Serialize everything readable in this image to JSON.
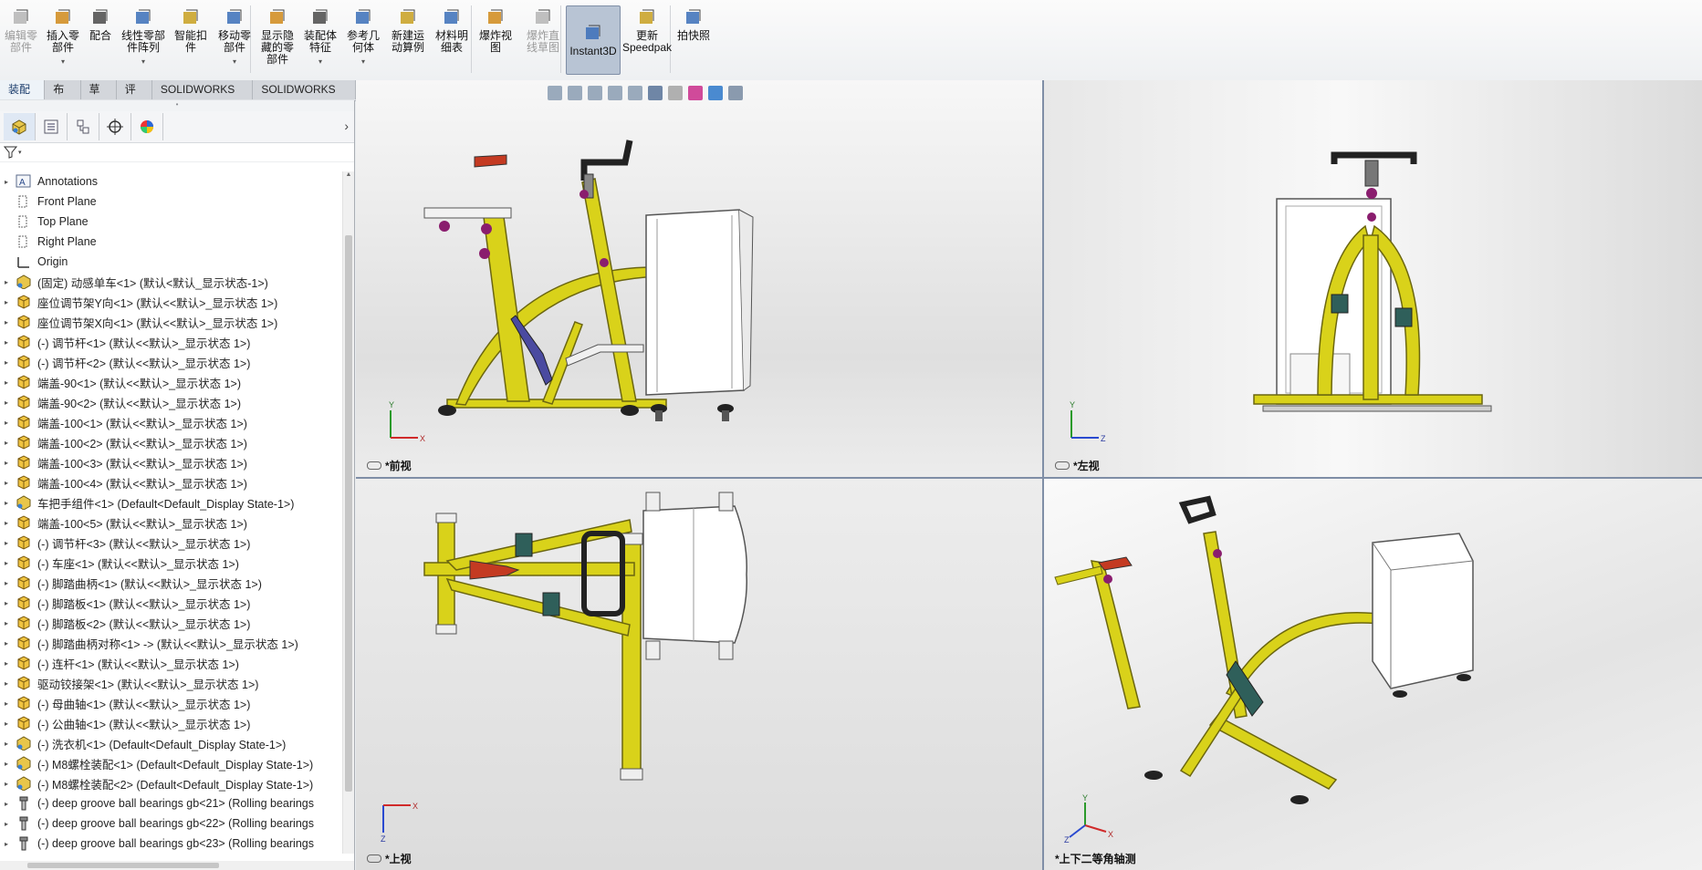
{
  "ribbon": {
    "buttons": [
      {
        "label": "编辑零\n部件",
        "icon": "edit-component-icon",
        "disabled": true
      },
      {
        "label": "插入零\n部件",
        "icon": "insert-component-icon"
      },
      {
        "label": "配合",
        "icon": "mate-icon"
      },
      {
        "label": "线性零部\n件阵列",
        "icon": "linear-pattern-icon"
      },
      {
        "label": "智能扣\n件",
        "icon": "smart-fastener-icon"
      },
      {
        "label": "移动零\n部件",
        "icon": "move-component-icon"
      },
      {
        "label": "显示隐\n藏的零\n部件",
        "icon": "show-hidden-icon"
      },
      {
        "label": "装配体\n特征",
        "icon": "assembly-feature-icon"
      },
      {
        "label": "参考几\n何体",
        "icon": "reference-geometry-icon"
      },
      {
        "label": "新建运\n动算例",
        "icon": "motion-study-icon"
      },
      {
        "label": "材料明\n细表",
        "icon": "bom-icon"
      },
      {
        "label": "爆炸视\n图",
        "icon": "exploded-view-icon"
      },
      {
        "label": "爆炸直\n线草图",
        "icon": "explode-line-icon",
        "disabled": true
      },
      {
        "label": "Instant3D",
        "icon": "instant3d-icon",
        "active": true
      },
      {
        "label": "更新\nSpeedpak",
        "icon": "speedpak-icon"
      },
      {
        "label": "拍快照",
        "icon": "snapshot-icon"
      }
    ]
  },
  "tabs": [
    "装配体",
    "布局",
    "草图",
    "评估",
    "SOLIDWORKS 插件",
    "SOLIDWORKS MBD"
  ],
  "tree": [
    {
      "label": "Annotations",
      "icon": "annotations-icon",
      "expander": true
    },
    {
      "label": "Front Plane",
      "icon": "plane-icon"
    },
    {
      "label": "Top Plane",
      "icon": "plane-icon"
    },
    {
      "label": "Right Plane",
      "icon": "plane-icon"
    },
    {
      "label": "Origin",
      "icon": "origin-icon"
    },
    {
      "label": "(固定) 动感单车<1> (默认<默认_显示状态-1>)",
      "icon": "assembly-icon",
      "expander": true
    },
    {
      "label": "座位调节架Y向<1> (默认<<默认>_显示状态 1>)",
      "icon": "part-icon",
      "expander": true
    },
    {
      "label": "座位调节架X向<1> (默认<<默认>_显示状态 1>)",
      "icon": "part-icon",
      "expander": true
    },
    {
      "label": "(-) 调节杆<1> (默认<<默认>_显示状态 1>)",
      "icon": "part-icon",
      "expander": true
    },
    {
      "label": "(-) 调节杆<2> (默认<<默认>_显示状态 1>)",
      "icon": "part-icon",
      "expander": true
    },
    {
      "label": "端盖-90<1> (默认<<默认>_显示状态 1>)",
      "icon": "part-icon",
      "expander": true
    },
    {
      "label": "端盖-90<2> (默认<<默认>_显示状态 1>)",
      "icon": "part-icon",
      "expander": true
    },
    {
      "label": "端盖-100<1> (默认<<默认>_显示状态 1>)",
      "icon": "part-icon",
      "expander": true
    },
    {
      "label": "端盖-100<2> (默认<<默认>_显示状态 1>)",
      "icon": "part-icon",
      "expander": true
    },
    {
      "label": "端盖-100<3> (默认<<默认>_显示状态 1>)",
      "icon": "part-icon",
      "expander": true
    },
    {
      "label": "端盖-100<4> (默认<<默认>_显示状态 1>)",
      "icon": "part-icon",
      "expander": true
    },
    {
      "label": "车把手组件<1> (Default<Default_Display State-1>)",
      "icon": "assembly-icon",
      "expander": true
    },
    {
      "label": "端盖-100<5> (默认<<默认>_显示状态 1>)",
      "icon": "part-icon",
      "expander": true
    },
    {
      "label": "(-) 调节杆<3> (默认<<默认>_显示状态 1>)",
      "icon": "part-icon",
      "expander": true
    },
    {
      "label": "(-) 车座<1> (默认<<默认>_显示状态 1>)",
      "icon": "part-icon",
      "expander": true
    },
    {
      "label": "(-) 脚踏曲柄<1> (默认<<默认>_显示状态 1>)",
      "icon": "part-icon",
      "expander": true
    },
    {
      "label": "(-) 脚踏板<1> (默认<<默认>_显示状态 1>)",
      "icon": "part-icon",
      "expander": true
    },
    {
      "label": "(-) 脚踏板<2> (默认<<默认>_显示状态 1>)",
      "icon": "part-icon",
      "expander": true
    },
    {
      "label": "(-) 脚踏曲柄对称<1> -> (默认<<默认>_显示状态 1>)",
      "icon": "part-icon",
      "expander": true
    },
    {
      "label": "(-) 连杆<1> (默认<<默认>_显示状态 1>)",
      "icon": "part-icon",
      "expander": true
    },
    {
      "label": "驱动铰接架<1> (默认<<默认>_显示状态 1>)",
      "icon": "part-icon",
      "expander": true
    },
    {
      "label": "(-) 母曲轴<1> (默认<<默认>_显示状态 1>)",
      "icon": "part-icon",
      "expander": true
    },
    {
      "label": "(-) 公曲轴<1> (默认<<默认>_显示状态 1>)",
      "icon": "part-icon",
      "expander": true
    },
    {
      "label": "(-) 洗衣机<1> (Default<Default_Display State-1>)",
      "icon": "assembly-icon",
      "expander": true
    },
    {
      "label": "(-) M8螺栓装配<1> (Default<Default_Display State-1>)",
      "icon": "assembly-icon",
      "expander": true
    },
    {
      "label": "(-) M8螺栓装配<2> (Default<Default_Display State-1>)",
      "icon": "assembly-icon",
      "expander": true
    },
    {
      "label": "(-) deep groove ball bearings gb<21> (Rolling bearings",
      "icon": "bolt-icon",
      "expander": true
    },
    {
      "label": "(-) deep groove ball bearings gb<22> (Rolling bearings",
      "icon": "bolt-icon",
      "expander": true
    },
    {
      "label": "(-) deep groove ball bearings gb<23> (Rolling bearings",
      "icon": "bolt-icon",
      "expander": true
    }
  ],
  "viewports": {
    "front": {
      "label": "*前视",
      "axes": [
        "Y",
        "X"
      ]
    },
    "left": {
      "label": "*左视",
      "axes": [
        "Y",
        "Z"
      ]
    },
    "top": {
      "label": "*上视",
      "axes": [
        "X",
        "Z"
      ]
    },
    "iso": {
      "label": "*上下二等角轴测",
      "axes": [
        "Y",
        "X",
        "Z"
      ]
    }
  },
  "colors": {
    "frame": "#d9d21a",
    "knob": "#8a1d6e",
    "handlebar": "#222222",
    "washer": "#ffffff",
    "accent": "#7f8ea6"
  }
}
